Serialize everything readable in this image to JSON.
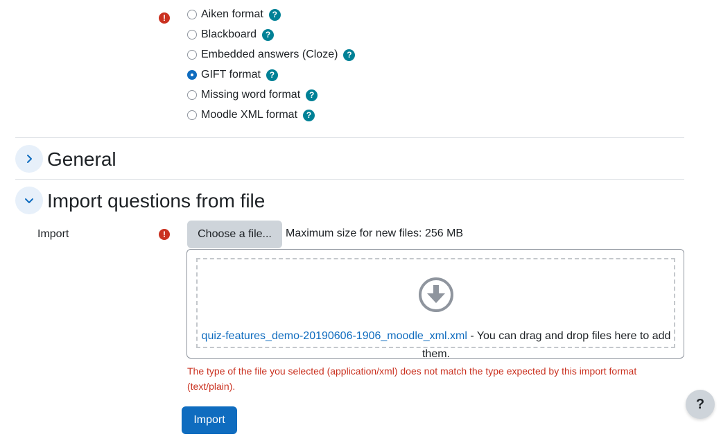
{
  "format": {
    "required_icon": "!",
    "options": [
      {
        "label": "Aiken format",
        "checked": false
      },
      {
        "label": "Blackboard",
        "checked": false
      },
      {
        "label": "Embedded answers (Cloze)",
        "checked": false
      },
      {
        "label": "GIFT format",
        "checked": true
      },
      {
        "label": "Missing word format",
        "checked": false
      },
      {
        "label": "Moodle XML format",
        "checked": false
      }
    ],
    "help_glyph": "?"
  },
  "sections": {
    "general": {
      "title": "General",
      "expanded": false
    },
    "import": {
      "title": "Import questions from file",
      "expanded": true
    }
  },
  "import_field": {
    "label": "Import",
    "required_icon": "!",
    "choose_button": "Choose a file...",
    "max_size": "Maximum size for new files: 256 MB",
    "file_name": "quiz-features_demo-20190606-1906_moodle_xml.xml",
    "drop_hint": " - You can drag and drop files here to add them.",
    "error": "The type of the file you selected (application/xml) does not match the type expected by this import format (text/plain)."
  },
  "import_button": "Import",
  "help_button": "?",
  "colors": {
    "primary": "#0f6cbf",
    "help": "#008196",
    "error": "#ca3120"
  },
  "icons": {
    "required": "exclamation-circle-icon",
    "help": "question-circle-icon",
    "collapsed": "chevron-right-icon",
    "expanded": "chevron-down-icon",
    "drop": "download-arrow-circle-icon"
  }
}
